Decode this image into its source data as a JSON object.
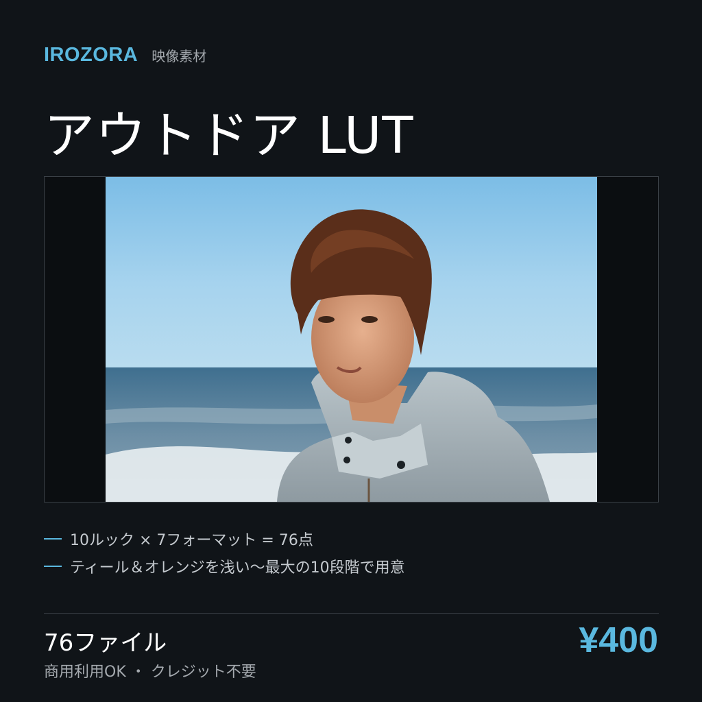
{
  "header": {
    "brand": "IROZORA",
    "category": "映像素材"
  },
  "product": {
    "title": "アウトドア LUT"
  },
  "features": [
    "10ルック × 7フォーマット = 76点",
    "ティール＆オレンジを浅い〜最大の10段階で用意"
  ],
  "footer": {
    "file_count": "76ファイル",
    "license": "商用利用OK ・ クレジット不要",
    "price": "¥400"
  },
  "colors": {
    "background": "#101418",
    "accent": "#5ab8df",
    "text_primary": "#ffffff",
    "text_secondary": "#a4a9ae"
  }
}
